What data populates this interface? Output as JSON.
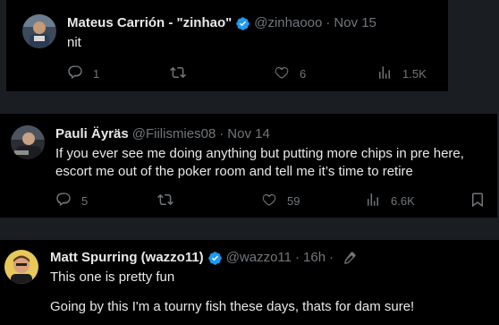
{
  "tweets": [
    {
      "name": "Mateus Carrión - \"zinhao\"",
      "handle": "@zinhaooo",
      "separator": "·",
      "date": "Nov 15",
      "text_lines": [
        "nit"
      ],
      "replies": "1",
      "retweets": "",
      "likes": "6",
      "views": "1.5K"
    },
    {
      "name": "Pauli Äyräs",
      "handle": "@Fiilismies08",
      "separator": "·",
      "date": "Nov 14",
      "text_lines": [
        "If you ever see me doing anything but putting more chips in pre here,",
        "escort me out of the poker room and tell me it’s time to retire"
      ],
      "replies": "5",
      "retweets": "",
      "likes": "59",
      "views": "6.6K"
    },
    {
      "name": "Matt Spurring (wazzo11)",
      "handle": "@wazzo11",
      "separator": "·",
      "date": "16h",
      "text_lines": [
        "This one is pretty fun",
        "Going by this I'm a tourny fish these days, thats for dam sure!"
      ]
    }
  ],
  "colors": {
    "background": "#000000",
    "text": "#e7e9ea",
    "muted": "#71767b",
    "verified": "#1d9bf0"
  },
  "icons": [
    "reply-icon",
    "retweet-icon",
    "like-icon",
    "views-icon",
    "bookmark-icon",
    "verified-badge-icon",
    "edit-icon"
  ]
}
